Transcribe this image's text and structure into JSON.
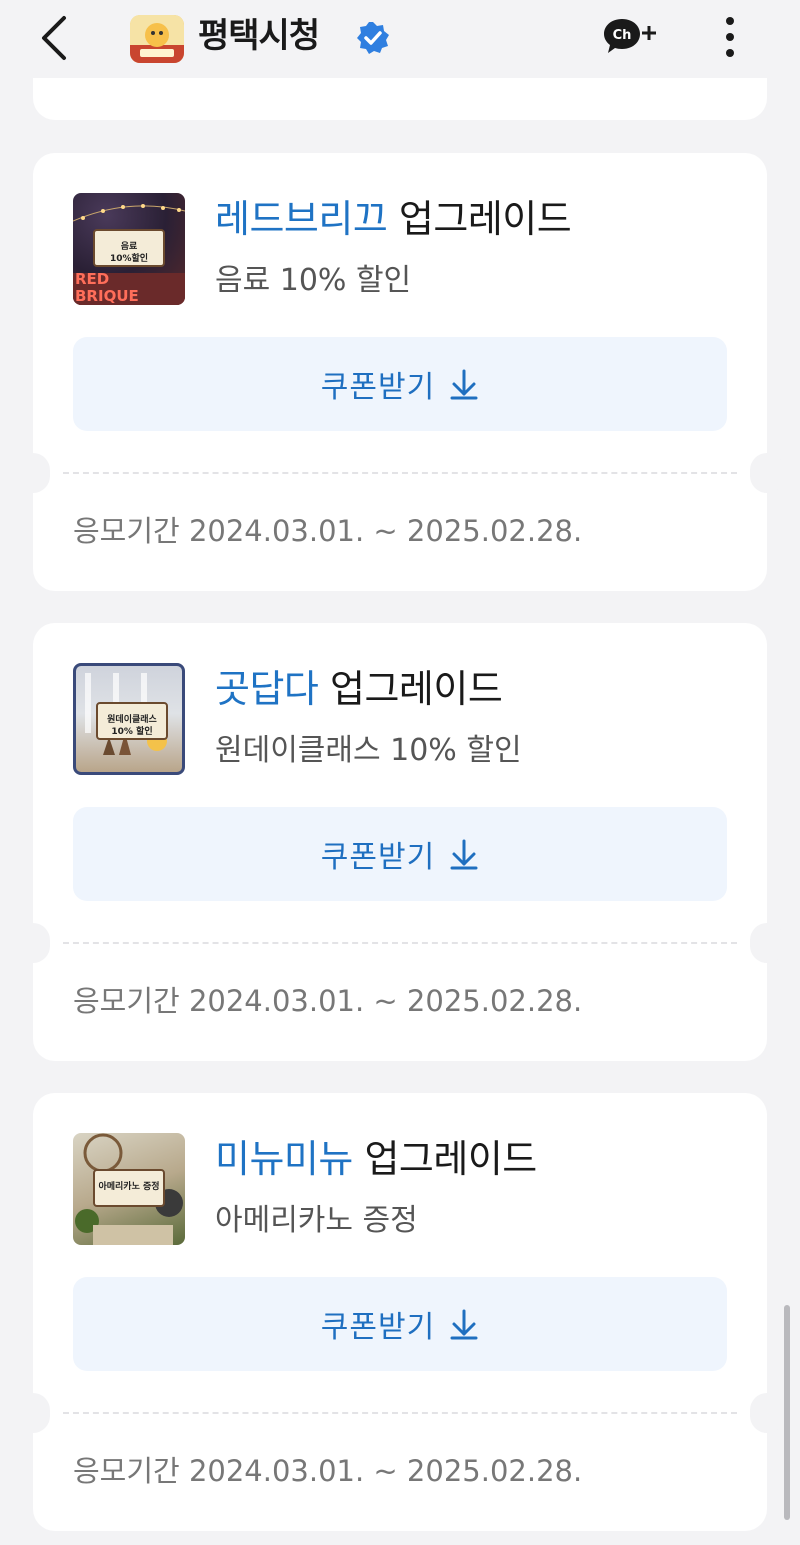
{
  "header": {
    "back_icon": "chevron-left-icon",
    "channel_name": "평택시청",
    "verified_icon": "verified-check-icon",
    "chat_icon": "ch-plus-icon",
    "chat_icon_text": "Ch",
    "more_icon": "more-vertical-icon"
  },
  "coupons": [
    {
      "shop": "레드브리끄",
      "kind": "업그레이드",
      "benefit": "음료 10% 할인",
      "thumb_tag": "음료\n10%할인",
      "thumb_sign": "RED BRIQUE",
      "button_label": "쿠폰받기",
      "period": "응모기간 2024.03.01. ~ 2025.02.28."
    },
    {
      "shop": "곳답다",
      "kind": "업그레이드",
      "benefit": "원데이클래스 10% 할인",
      "thumb_tag": "원데이클래스\n10% 할인",
      "button_label": "쿠폰받기",
      "period": "응모기간 2024.03.01. ~ 2025.02.28."
    },
    {
      "shop": "미뉴미뉴",
      "kind": "업그레이드",
      "benefit": "아메리카노 증정",
      "thumb_tag": "아메리카노 증정",
      "button_label": "쿠폰받기",
      "period": "응모기간 2024.03.01. ~ 2025.02.28."
    }
  ],
  "colors": {
    "accent": "#1f73c4",
    "button_bg": "#eff5fd",
    "page_bg": "#f3f3f5",
    "verified": "#2f7fe0"
  }
}
